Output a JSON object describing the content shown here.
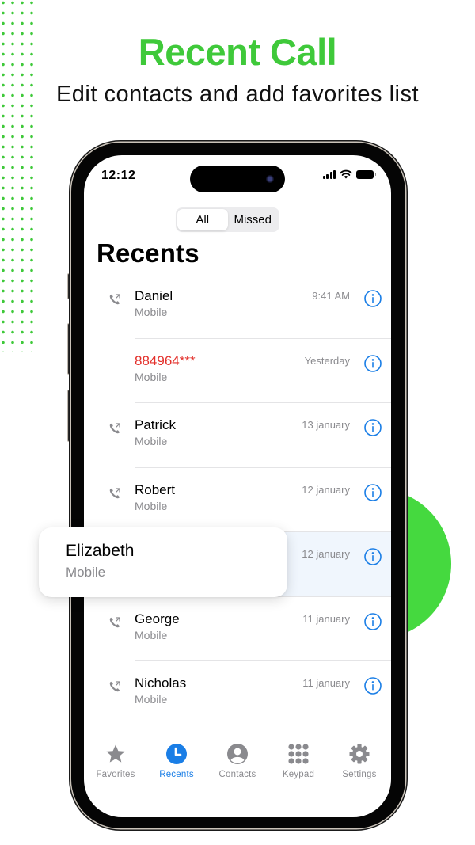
{
  "promo": {
    "headline": "Recent Call",
    "subline": "Edit contacts and add favorites list",
    "accent_color": "#3fc93a"
  },
  "status_bar": {
    "time": "12:12",
    "icons": [
      "signal-icon",
      "wifi-icon",
      "battery-icon"
    ]
  },
  "segmented_control": {
    "options": [
      {
        "label": "All",
        "selected": true
      },
      {
        "label": "Missed",
        "selected": false
      }
    ]
  },
  "page_title": "Recents",
  "calls": [
    {
      "name": "Daniel",
      "type": "Mobile",
      "when": "9:41 AM",
      "missed": false,
      "outgoing": true
    },
    {
      "name": "884964***",
      "type": "Mobile",
      "when": "Yesterday",
      "missed": true,
      "outgoing": false
    },
    {
      "name": "Patrick",
      "type": "Mobile",
      "when": "13 january",
      "missed": false,
      "outgoing": true
    },
    {
      "name": "Robert",
      "type": "Mobile",
      "when": "12 january",
      "missed": false,
      "outgoing": true
    },
    {
      "name": "Elizabeth",
      "type": "Mobile",
      "when": "12 january",
      "missed": false,
      "outgoing": true,
      "highlighted": true
    },
    {
      "name": "George",
      "type": "Mobile",
      "when": "11 january",
      "missed": false,
      "outgoing": true
    },
    {
      "name": "Nicholas",
      "type": "Mobile",
      "when": "11 january",
      "missed": false,
      "outgoing": true
    }
  ],
  "floating_card": {
    "name": "Elizabeth",
    "type": "Mobile"
  },
  "tab_bar": {
    "active_color": "#1a7ee6",
    "tabs": [
      {
        "label": "Favorites",
        "icon": "star-icon",
        "active": false
      },
      {
        "label": "Recents",
        "icon": "clock-icon",
        "active": true
      },
      {
        "label": "Contacts",
        "icon": "person-circle-icon",
        "active": false
      },
      {
        "label": "Keypad",
        "icon": "keypad-icon",
        "active": false
      },
      {
        "label": "Settings",
        "icon": "gear-icon",
        "active": false
      }
    ]
  }
}
